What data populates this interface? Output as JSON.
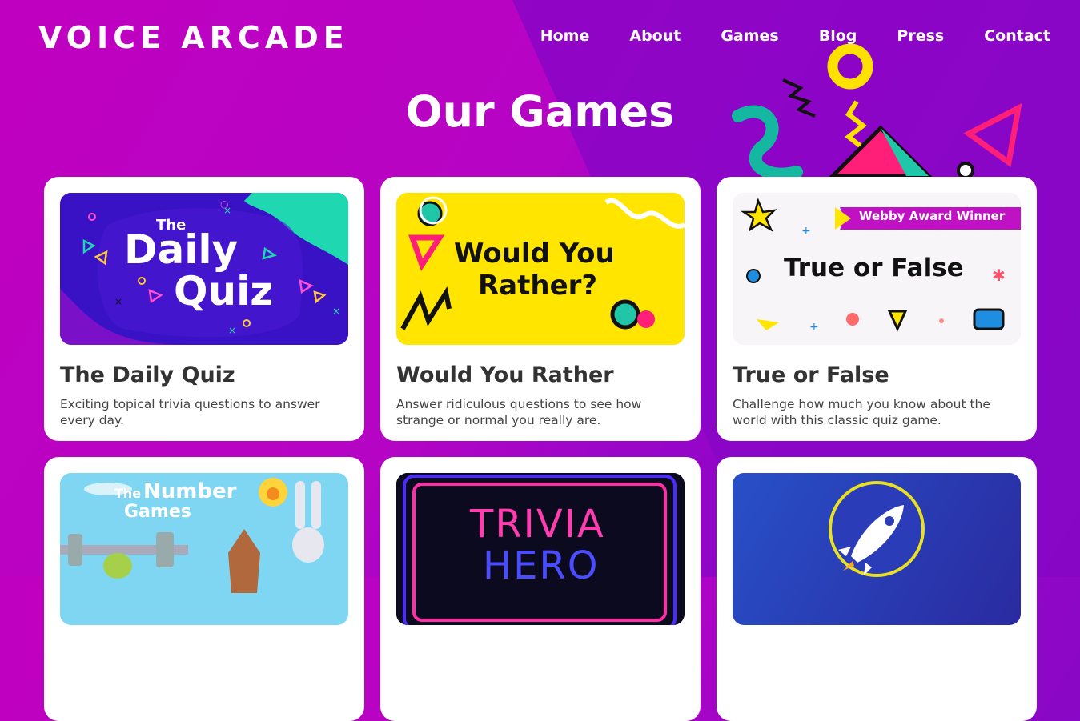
{
  "brand": {
    "logo_text": "VOICE ARCADE"
  },
  "nav": {
    "items": [
      {
        "label": "Home"
      },
      {
        "label": "About"
      },
      {
        "label": "Games"
      },
      {
        "label": "Blog"
      },
      {
        "label": "Press"
      },
      {
        "label": "Contact"
      }
    ]
  },
  "page": {
    "title": "Our Games"
  },
  "colors": {
    "bg_magenta": "#c000c0",
    "bg_purple": "#7a08c4",
    "card_bg": "#ffffff",
    "yellow": "#ffe500",
    "teal": "#1fc6a8",
    "pink": "#ff1e78"
  },
  "games": [
    {
      "thumb_line1": "The",
      "thumb_line2": "Daily",
      "thumb_line3": "Quiz",
      "title": "The Daily Quiz",
      "description": "Exciting topical trivia questions to answer every day."
    },
    {
      "thumb_line1": "Would You",
      "thumb_line2": "Rather?",
      "title": "Would You Rather",
      "description": "Answer ridiculous questions to see how strange or normal you really are."
    },
    {
      "badge": "Webby Award Winner",
      "thumb_line1": "True or False",
      "title": "True or False",
      "description": "Challenge how much you know about the world with this classic quiz game."
    },
    {
      "thumb_line1": "The",
      "thumb_line2": "Number",
      "thumb_line3": "Games"
    },
    {
      "thumb_line1": "TRIVIA",
      "thumb_line2": "HERO"
    },
    {
      "icon": "rocket-icon"
    }
  ]
}
